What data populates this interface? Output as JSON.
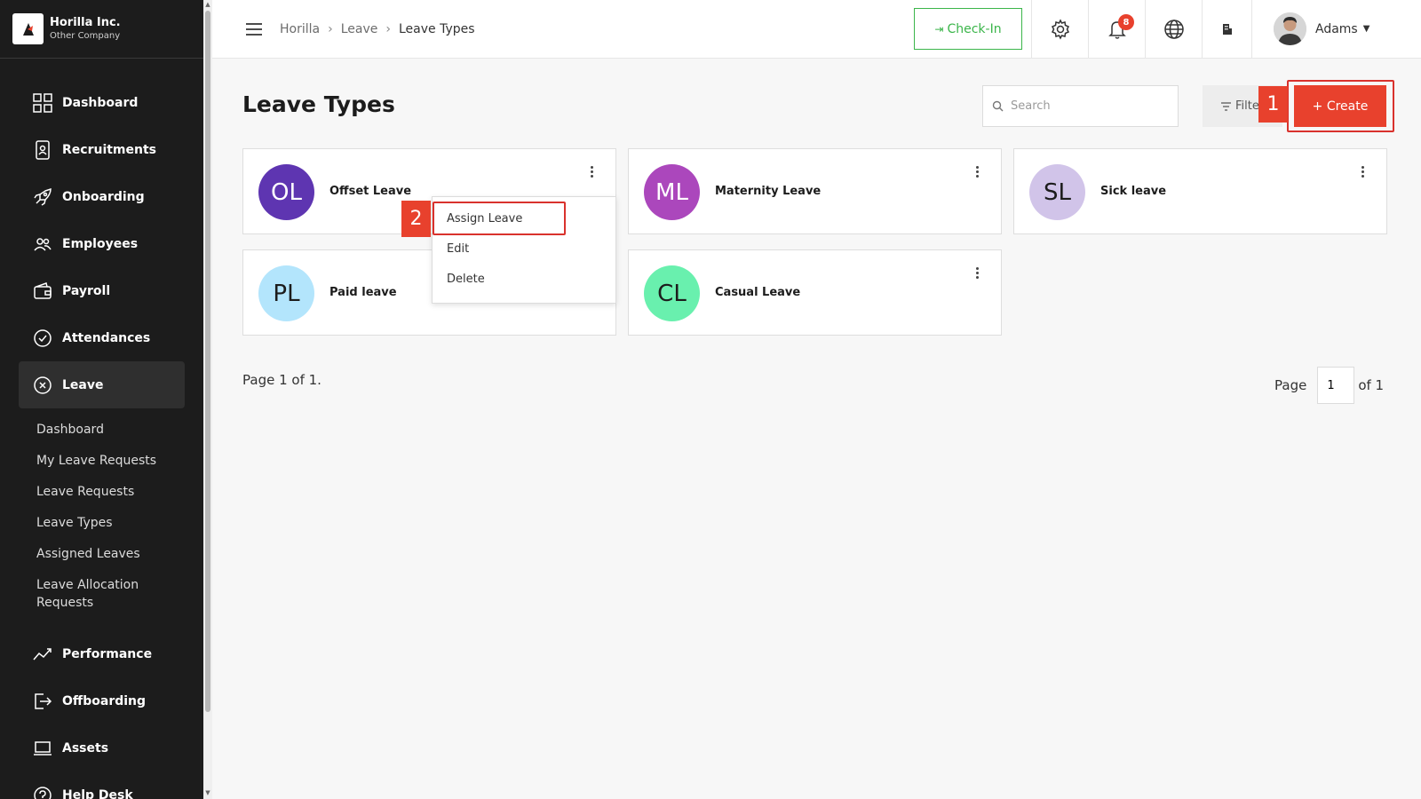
{
  "company": {
    "name": "Horilla Inc.",
    "subtitle": "Other Company"
  },
  "sidebar": {
    "items": [
      {
        "label": "Dashboard",
        "icon": "dashboard-icon"
      },
      {
        "label": "Recruitments",
        "icon": "recruitment-icon"
      },
      {
        "label": "Onboarding",
        "icon": "rocket-icon"
      },
      {
        "label": "Employees",
        "icon": "people-icon"
      },
      {
        "label": "Payroll",
        "icon": "wallet-icon"
      },
      {
        "label": "Attendances",
        "icon": "check-circle-icon"
      },
      {
        "label": "Leave",
        "icon": "leave-icon"
      }
    ],
    "leave_submenu": [
      "Dashboard",
      "My Leave Requests",
      "Leave Requests",
      "Leave Types",
      "Assigned Leaves",
      "Leave Allocation Requests"
    ],
    "items_after": [
      {
        "label": "Performance",
        "icon": "chart-line-icon"
      },
      {
        "label": "Offboarding",
        "icon": "exit-icon"
      },
      {
        "label": "Assets",
        "icon": "laptop-icon"
      },
      {
        "label": "Help Desk",
        "icon": "help-icon"
      }
    ]
  },
  "header": {
    "breadcrumbs": [
      "Horilla",
      "Leave",
      "Leave Types"
    ],
    "checkin_label": "Check-In",
    "notification_count": "8",
    "user_name": "Adams"
  },
  "main": {
    "title": "Leave Types",
    "search_placeholder": "Search",
    "filter_label": "Filter",
    "create_label": "+ Create",
    "cards": [
      {
        "initials": "OL",
        "name": "Offset Leave",
        "color": "#5e35b1"
      },
      {
        "initials": "ML",
        "name": "Maternity Leave",
        "color": "#ab47bc"
      },
      {
        "initials": "SL",
        "name": "Sick leave",
        "color": "#d1c4e9"
      },
      {
        "initials": "PL",
        "name": "Paid leave",
        "color": "#b3e5fc"
      },
      {
        "initials": "CL",
        "name": "Casual Leave",
        "color": "#69f0ae"
      }
    ],
    "dropdown": [
      "Assign Leave",
      "Edit",
      "Delete"
    ],
    "page_info": "Page 1 of 1.",
    "pager": {
      "page_label": "Page",
      "current": "1",
      "total_label": "of 1"
    }
  },
  "annotations": {
    "marker_1": "1",
    "marker_2": "2"
  }
}
